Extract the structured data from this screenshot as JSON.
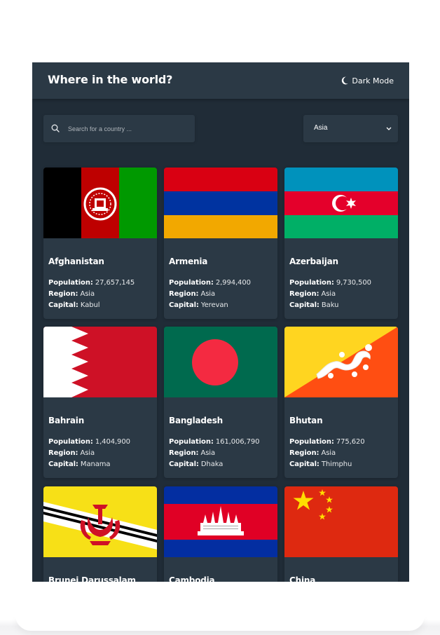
{
  "header": {
    "title": "Where in the world?",
    "mode_label": "Dark Mode",
    "mode_icon": "moon-icon"
  },
  "search": {
    "placeholder": "Search for a country ...",
    "value": "",
    "icon": "search-icon"
  },
  "region_filter": {
    "selected": "Asia",
    "icon": "chevron-down-icon"
  },
  "labels": {
    "population": "Population:",
    "region": "Region:",
    "capital": "Capital:"
  },
  "countries": [
    {
      "name": "Afghanistan",
      "population": "27,657,145",
      "region": "Asia",
      "capital": "Kabul"
    },
    {
      "name": "Armenia",
      "population": "2,994,400",
      "region": "Asia",
      "capital": "Yerevan"
    },
    {
      "name": "Azerbaijan",
      "population": "9,730,500",
      "region": "Asia",
      "capital": "Baku"
    },
    {
      "name": "Bahrain",
      "population": "1,404,900",
      "region": "Asia",
      "capital": "Manama"
    },
    {
      "name": "Bangladesh",
      "population": "161,006,790",
      "region": "Asia",
      "capital": "Dhaka"
    },
    {
      "name": "Bhutan",
      "population": "775,620",
      "region": "Asia",
      "capital": "Thimphu"
    },
    {
      "name": "Brunei Darussalam"
    },
    {
      "name": "Cambodia"
    },
    {
      "name": "China"
    }
  ],
  "colors": {
    "background": "#202c37",
    "elements": "#2b3945",
    "text": "#ffffff"
  }
}
